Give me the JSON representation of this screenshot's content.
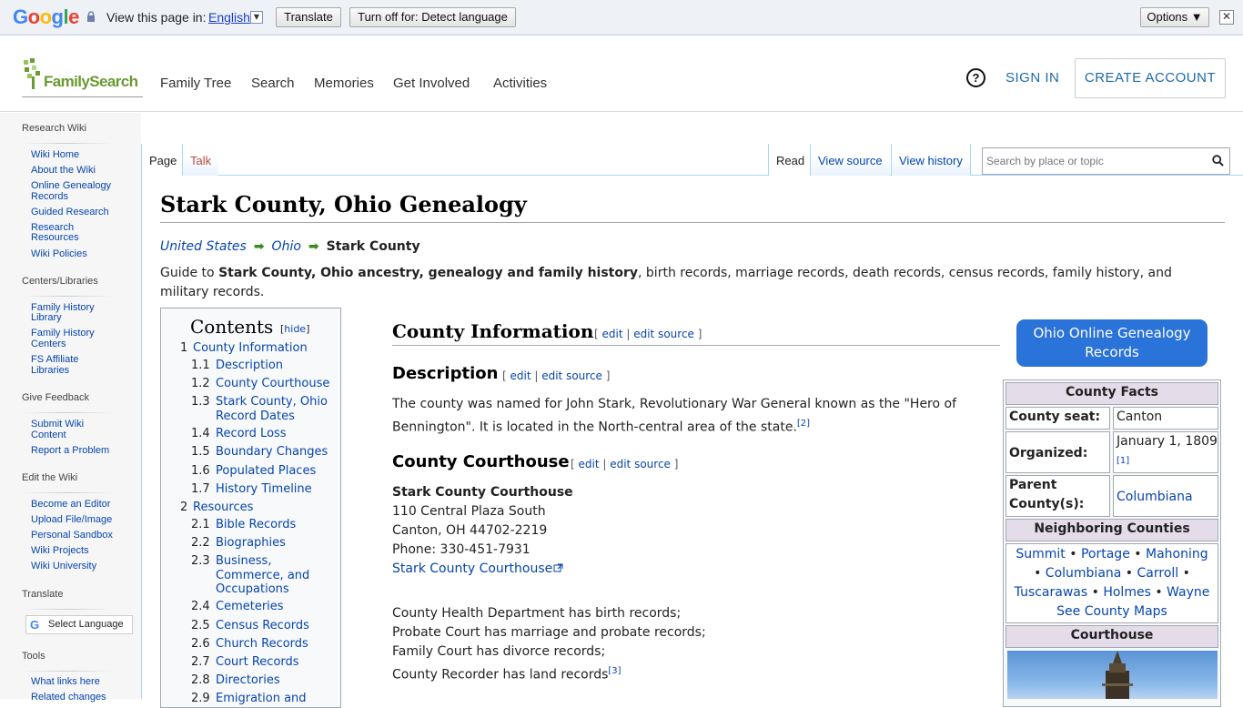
{
  "translate_bar": {
    "logo": [
      "G",
      "o",
      "o",
      "g",
      "l",
      "e"
    ],
    "view_label": "View this page in:",
    "language": "English",
    "translate_btn": "Translate",
    "turnoff_btn": "Turn off for: Detect language",
    "options_btn": "Options ▼",
    "close": "✕"
  },
  "header": {
    "logo_text": "FamilySearch",
    "nav": [
      "Family Tree",
      "Search",
      "Memories",
      "Get Involved",
      "Activities"
    ],
    "help": "?",
    "sign_in": "SIGN IN",
    "create_account": "CREATE ACCOUNT"
  },
  "sidebar": {
    "research_wiki": "Research Wiki",
    "wiki_links": [
      "Wiki Home",
      "About the Wiki",
      "Online Genealogy",
      "Records",
      "Guided Research",
      "Research",
      "Resources",
      "Wiki Policies"
    ],
    "centers": "Centers/Libraries",
    "centers_links": [
      "Family History",
      "Library",
      "Family History",
      "Centers",
      "FS Affiliate",
      "Libraries"
    ],
    "feedback": "Give Feedback",
    "feedback_links": [
      "Submit Wiki",
      "Content",
      "Report a Problem"
    ],
    "edit": "Edit the Wiki",
    "edit_links": [
      "Become an Editor",
      "Upload File/Image",
      "Personal Sandbox",
      "Wiki Projects",
      "Wiki University"
    ],
    "translate": "Translate",
    "select_language": "Select Language",
    "tools": "Tools",
    "tools_links": [
      "What links here",
      "Related changes"
    ]
  },
  "tabs": {
    "page": "Page",
    "talk": "Talk",
    "read": "Read",
    "view_source": "View source",
    "view_history": "View history",
    "search_placeholder": "Search by place or topic"
  },
  "article": {
    "title": "Stark County, Ohio Genealogy",
    "crumbs": [
      "United States",
      "Ohio",
      "Stark County"
    ],
    "arrow": "➡",
    "guide_pre": "Guide to ",
    "guide_bold": "Stark County, Ohio ancestry, genealogy and family history",
    "guide_post": ", birth records, marriage records, death records, census records, family history, and military records.",
    "contents": "Contents",
    "hide": "hide",
    "toc": [
      {
        "n": "1",
        "t": "County Information"
      },
      {
        "n": "1.1",
        "t": "Description"
      },
      {
        "n": "1.2",
        "t": "County Courthouse"
      },
      {
        "n": "1.3",
        "t": "Stark County, Ohio"
      },
      {
        "n": "",
        "t": "Record Dates"
      },
      {
        "n": "1.4",
        "t": "Record Loss"
      },
      {
        "n": "1.5",
        "t": "Boundary Changes"
      },
      {
        "n": "1.6",
        "t": "Populated Places"
      },
      {
        "n": "1.7",
        "t": "History Timeline"
      },
      {
        "n": "2",
        "t": "Resources"
      },
      {
        "n": "2.1",
        "t": "Bible Records"
      },
      {
        "n": "2.2",
        "t": "Biographies"
      },
      {
        "n": "2.3",
        "t": "Business,"
      },
      {
        "n": "",
        "t": "Commerce, and"
      },
      {
        "n": "",
        "t": "Occupations"
      },
      {
        "n": "2.4",
        "t": "Cemeteries"
      },
      {
        "n": "2.5",
        "t": "Census Records"
      },
      {
        "n": "2.6",
        "t": "Church Records"
      },
      {
        "n": "2.7",
        "t": "Court Records"
      },
      {
        "n": "2.8",
        "t": "Directories"
      },
      {
        "n": "2.9",
        "t": "Emigration and"
      }
    ],
    "county_info": "County Information",
    "edit": "edit",
    "edit_source": "edit source",
    "description_h": "Description",
    "description": "The county was named for John Stark, Revolutionary War General known as the \"Hero of Bennington\". It is located in the North-central area of the state.",
    "ref2": "[2]",
    "courthouse_h": "County Courthouse",
    "courthouse_name": "Stark County Courthouse",
    "address1": "110 Central Plaza South",
    "address2": "Canton, OH 44702-2219",
    "phone": "Phone: 330-451-7931",
    "courthouse_link": "Stark County Courthouse",
    "records1": "County Health Department has birth records;",
    "records2": "Probate Court has marriage and probate records;",
    "records3": "Family Court has divorce records;",
    "records4": "County Recorder has land records",
    "ref3": "[3]"
  },
  "infobox": {
    "button": "Ohio Online Genealogy Records",
    "facts": "County Facts",
    "seat_label": "County seat:",
    "seat": "Canton",
    "organized_label": "Organized:",
    "organized": "January 1, 1809",
    "ref1": "[1]",
    "parent_label": "Parent County(s):",
    "parent": "Columbiana",
    "neighbors_h": "Neighboring Counties",
    "neighbors": [
      "Summit",
      "Portage",
      "Mahoning",
      "Columbiana",
      "Carroll",
      "Tuscarawas",
      "Holmes",
      "Wayne"
    ],
    "maps": "See County Maps",
    "courthouse_h": "Courthouse"
  },
  "colors": {
    "link": "#0645ad",
    "brand_green": "#6a9a31",
    "button_blue": "#2a73d8"
  }
}
